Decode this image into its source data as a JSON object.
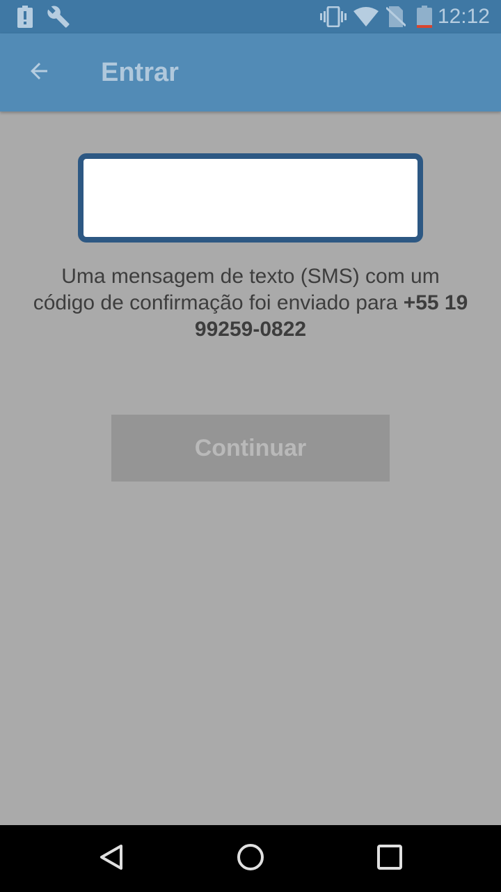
{
  "status_bar": {
    "time": "12:12",
    "left_icons": [
      "battery-alert-icon",
      "wrench-icon"
    ],
    "right_icons": [
      "vibrate-icon",
      "wifi-icon",
      "no-sim-icon",
      "battery-low-icon"
    ]
  },
  "app_bar": {
    "title": "Entrar",
    "back_icon": "arrow-back-icon"
  },
  "code_input": {
    "value": "",
    "placeholder": ""
  },
  "message": {
    "text": "Uma mensagem de texto (SMS) com um código de confirmação foi enviado para ",
    "phone": "+55 19 99259-0822"
  },
  "continue_button": {
    "label": "Continuar"
  },
  "nav_bar": {
    "buttons": [
      "back-triangle-icon",
      "home-circle-icon",
      "recents-square-icon"
    ]
  },
  "colors": {
    "status_bar": "#3f78a4",
    "app_bar": "#528bb6",
    "background": "#aaaaaa",
    "input_border": "#2d5883",
    "button_bg": "#959595",
    "battery_warning": "#d9452f"
  }
}
